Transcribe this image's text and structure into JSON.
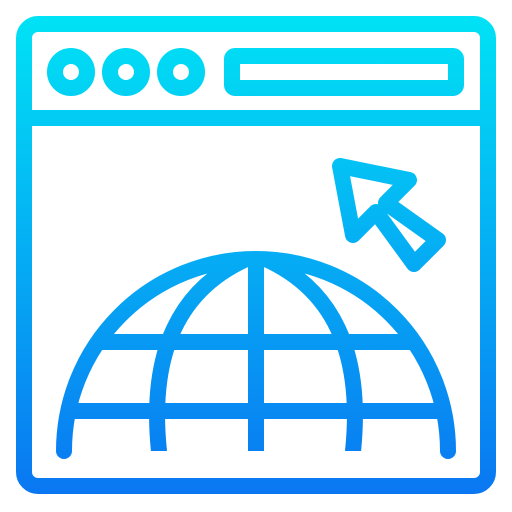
{
  "icon": {
    "name": "web-browser-globe-click-icon",
    "gradient": {
      "top_color": "#00e6f5",
      "bottom_color": "#0a73f2"
    },
    "window_controls": {
      "buttons": [
        "dot",
        "dot",
        "dot"
      ]
    },
    "address_bar": {
      "text": ""
    }
  }
}
